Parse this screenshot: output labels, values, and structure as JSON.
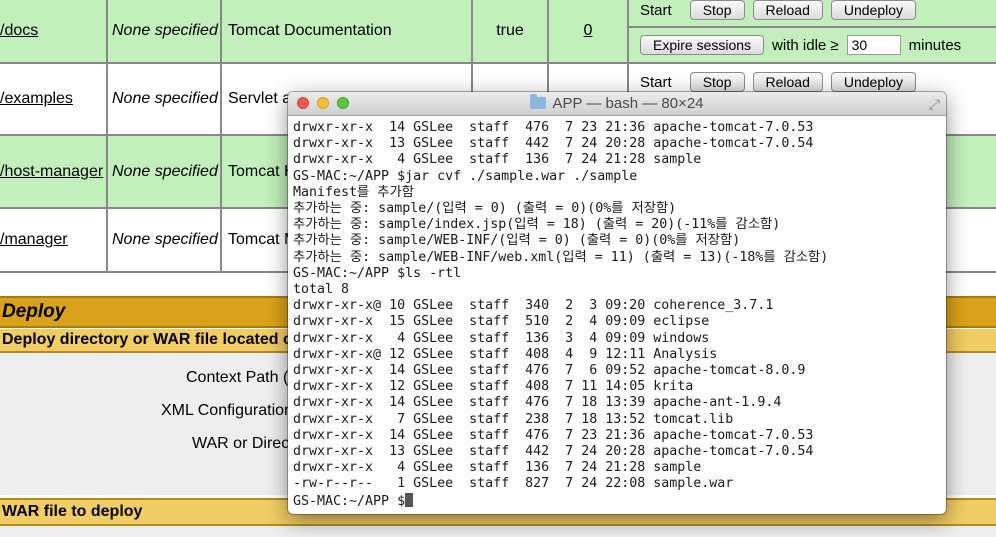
{
  "manager_rows": [
    {
      "path": "/docs",
      "version": "None specified",
      "display_name": "Tomcat Documentation",
      "running": "true",
      "sessions": "0"
    },
    {
      "path": "/examples",
      "version": "None specified",
      "display_name": "Servlet a",
      "running": "",
      "sessions": ""
    },
    {
      "path": "/host-manager",
      "version": "None specified",
      "display_name": "Tomcat H",
      "running": "",
      "sessions": ""
    },
    {
      "path": "/manager",
      "version": "None specified",
      "display_name": "Tomcat M",
      "running": "",
      "sessions": ""
    }
  ],
  "commands": {
    "start": "Start",
    "stop": "Stop",
    "reload": "Reload",
    "undeploy": "Undeploy",
    "expire_sessions": "Expire sessions",
    "with_idle": "with idle ≥",
    "idle_value": "30",
    "minutes": "minutes"
  },
  "deploy": {
    "heading": "Deploy",
    "subheading": "Deploy directory or WAR file located on s",
    "context_path_label": "Context Path (r",
    "xml_config_label": "XML Configuration",
    "war_or_dir_label": "WAR or Direct",
    "war_file_heading": "WAR file to deploy"
  },
  "terminal": {
    "title": "APP — bash — 80×24",
    "lines": [
      "drwxr-xr-x  14 GSLee  staff  476  7 23 21:36 apache-tomcat-7.0.53",
      "drwxr-xr-x  13 GSLee  staff  442  7 24 20:28 apache-tomcat-7.0.54",
      "drwxr-xr-x   4 GSLee  staff  136  7 24 21:28 sample",
      "GS-MAC:~/APP $jar cvf ./sample.war ./sample",
      "Manifest를 추가함",
      "추가하는 중: sample/(입력 = 0) (출력 = 0)(0%를 저장함)",
      "추가하는 중: sample/index.jsp(입력 = 18) (출력 = 20)(-11%를 감소함)",
      "추가하는 중: sample/WEB-INF/(입력 = 0) (출력 = 0)(0%를 저장함)",
      "추가하는 중: sample/WEB-INF/web.xml(입력 = 11) (출력 = 13)(-18%를 감소함)",
      "GS-MAC:~/APP $ls -rtl",
      "total 8",
      "drwxr-xr-x@ 10 GSLee  staff  340  2  3 09:20 coherence_3.7.1",
      "drwxr-xr-x  15 GSLee  staff  510  2  4 09:09 eclipse",
      "drwxr-xr-x   4 GSLee  staff  136  3  4 09:09 windows",
      "drwxr-xr-x@ 12 GSLee  staff  408  4  9 12:11 Analysis",
      "drwxr-xr-x  14 GSLee  staff  476  7  6 09:52 apache-tomcat-8.0.9",
      "drwxr-xr-x  12 GSLee  staff  408  7 11 14:05 krita",
      "drwxr-xr-x  14 GSLee  staff  476  7 18 13:39 apache-ant-1.9.4",
      "drwxr-xr-x   7 GSLee  staff  238  7 18 13:52 tomcat.lib",
      "drwxr-xr-x  14 GSLee  staff  476  7 23 21:36 apache-tomcat-7.0.53",
      "drwxr-xr-x  13 GSLee  staff  442  7 24 20:28 apache-tomcat-7.0.54",
      "drwxr-xr-x   4 GSLee  staff  136  7 24 21:28 sample",
      "-rw-r--r--   1 GSLee  staff  827  7 24 22:08 sample.war"
    ],
    "prompt": "GS-MAC:~/APP $"
  }
}
